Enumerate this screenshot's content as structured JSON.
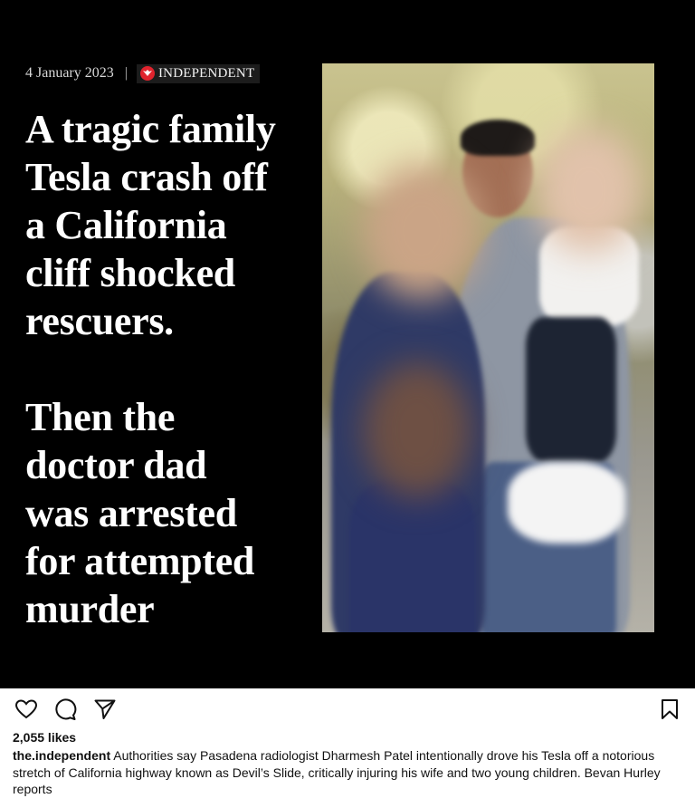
{
  "post": {
    "dateline": "4 January 2023",
    "separator": "|",
    "brand": "INDEPENDENT",
    "headline_1": [
      "A tragic family",
      "Tesla crash off",
      "a California",
      "cliff shocked",
      "rescuers."
    ],
    "headline_2": [
      "Then the",
      "doctor dad",
      "was arrested",
      "for attempted",
      "murder"
    ]
  },
  "actions": {
    "like_icon": "heart-icon",
    "comment_icon": "comment-icon",
    "share_icon": "send-icon",
    "save_icon": "bookmark-icon"
  },
  "likes": "2,055 likes",
  "caption": {
    "username": "the.independent",
    "text": "Authorities say Pasadena radiologist Dharmesh Patel intentionally drove his Tesla off a notorious stretch of California highway known as Devil’s Slide, critically injuring his wife and two young children. Bevan Hurley reports"
  },
  "colors": {
    "brand_red": "#e0232d",
    "background": "#000000"
  }
}
